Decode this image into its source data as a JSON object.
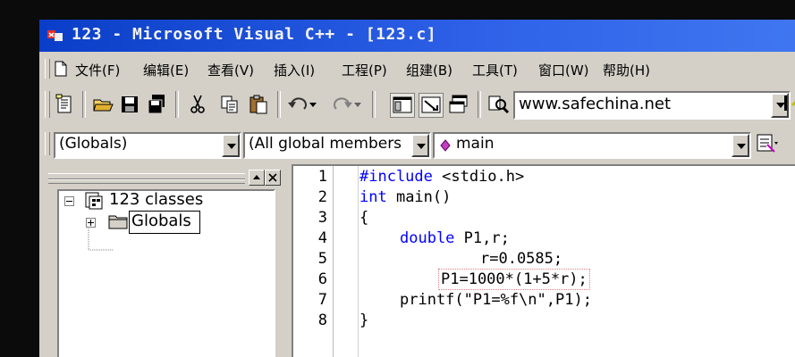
{
  "window": {
    "title": "123 - Microsoft Visual C++ - [123.c]"
  },
  "menu": {
    "items": [
      "文件(F)",
      "编辑(E)",
      "查看(V)",
      "插入(I)",
      "工程(P)",
      "组建(B)",
      "工具(T)",
      "窗口(W)",
      "帮助(H)"
    ]
  },
  "toolbar": {
    "url": "www.safechina.net"
  },
  "wizardbar": {
    "class_combo": "(Globals)",
    "filter_combo": "(All global members",
    "member_combo": "main"
  },
  "classview": {
    "root_label": "123 classes",
    "folder_label": "Globals"
  },
  "editor": {
    "line_numbers": [
      "1",
      "2",
      "3",
      "4",
      "5",
      "6",
      "7",
      "8"
    ],
    "lines": [
      {
        "keyword": "#include",
        "rest": " <stdio.h>"
      },
      {
        "keyword": "int",
        "rest": " main()"
      },
      {
        "keyword": "",
        "rest": "{"
      },
      {
        "keyword": "double",
        "rest": " P1,r;"
      },
      {
        "keyword": "",
        "rest": "r=0.0585;"
      },
      {
        "keyword": "",
        "rest": "P1=1000*(1+5*r);"
      },
      {
        "keyword": "",
        "rest": "printf(\"P1=%f\\n\",P1);"
      },
      {
        "keyword": "",
        "rest": "}"
      }
    ]
  },
  "colors": {
    "titlebar": "#0a3ec8",
    "keyword": "#0000ff",
    "chrome": "#d4d0c8"
  }
}
